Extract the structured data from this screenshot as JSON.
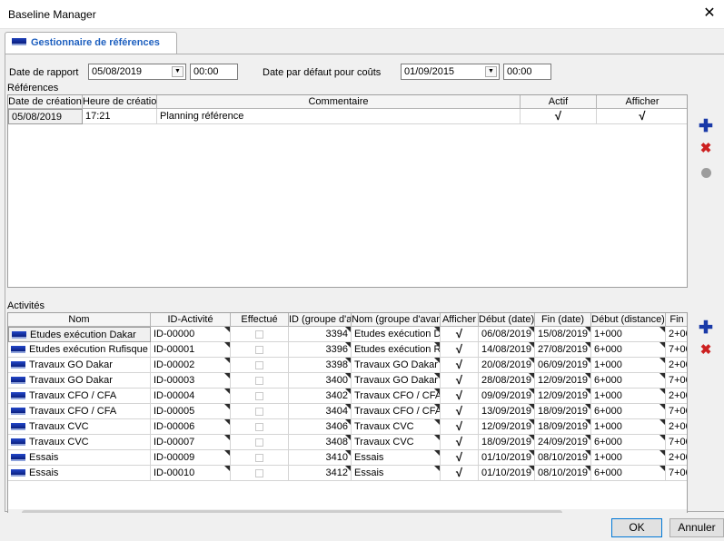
{
  "window": {
    "title": "Baseline Manager",
    "close_glyph": "✕"
  },
  "tab": {
    "label": "Gestionnaire de références",
    "icon": "baseline-icon"
  },
  "report": {
    "label": "Date de rapport",
    "date": "05/08/2019",
    "time": "00:00",
    "cost_label": "Date par défaut pour coûts",
    "cost_date": "01/09/2015",
    "cost_time": "00:00"
  },
  "references": {
    "section_label": "Références",
    "columns": [
      "Date de création",
      "Heure de création",
      "Commentaire",
      "Actif",
      "Afficher"
    ],
    "rows": [
      {
        "date": "05/08/2019",
        "time": "17:21",
        "comment": "Planning référence",
        "active": "√",
        "show": "√"
      }
    ]
  },
  "activities": {
    "section_label": "Activités",
    "columns": [
      "Nom",
      "ID-Activité",
      "Effectué",
      "ID (groupe d'a",
      "Nom (groupe d'avan",
      "Afficher",
      "Début (date)",
      "Fin (date)",
      "Début (distance)",
      "Fin"
    ],
    "rows": [
      {
        "name": "Etudes exécution Dakar",
        "id": "ID-00000",
        "done": false,
        "group_id": "3394",
        "group_name": "Etudes exécution D",
        "show": "√",
        "start": "06/08/2019",
        "end": "15/08/2019",
        "start_dist": "1+000",
        "end_dist": "2+00"
      },
      {
        "name": "Etudes exécution Rufisque",
        "id": "ID-00001",
        "done": false,
        "group_id": "3396",
        "group_name": "Etudes exécution R",
        "show": "√",
        "start": "14/08/2019",
        "end": "27/08/2019",
        "start_dist": "6+000",
        "end_dist": "7+00"
      },
      {
        "name": "Travaux GO Dakar",
        "id": "ID-00002",
        "done": false,
        "group_id": "3398",
        "group_name": "Travaux GO Dakar",
        "show": "√",
        "start": "20/08/2019",
        "end": "06/09/2019",
        "start_dist": "1+000",
        "end_dist": "2+00"
      },
      {
        "name": "Travaux GO Dakar",
        "id": "ID-00003",
        "done": false,
        "group_id": "3400",
        "group_name": "Travaux GO Dakar",
        "show": "√",
        "start": "28/08/2019",
        "end": "12/09/2019",
        "start_dist": "6+000",
        "end_dist": "7+00"
      },
      {
        "name": "Travaux CFO / CFA",
        "id": "ID-00004",
        "done": false,
        "group_id": "3402",
        "group_name": "Travaux CFO / CFA",
        "show": "√",
        "start": "09/09/2019",
        "end": "12/09/2019",
        "start_dist": "1+000",
        "end_dist": "2+00"
      },
      {
        "name": "Travaux CFO / CFA",
        "id": "ID-00005",
        "done": false,
        "group_id": "3404",
        "group_name": "Travaux CFO / CFA",
        "show": "√",
        "start": "13/09/2019",
        "end": "18/09/2019",
        "start_dist": "6+000",
        "end_dist": "7+00"
      },
      {
        "name": "Travaux CVC",
        "id": "ID-00006",
        "done": false,
        "group_id": "3406",
        "group_name": "Travaux CVC",
        "show": "√",
        "start": "12/09/2019",
        "end": "18/09/2019",
        "start_dist": "1+000",
        "end_dist": "2+00"
      },
      {
        "name": "Travaux CVC",
        "id": "ID-00007",
        "done": false,
        "group_id": "3408",
        "group_name": "Travaux CVC",
        "show": "√",
        "start": "18/09/2019",
        "end": "24/09/2019",
        "start_dist": "6+000",
        "end_dist": "7+00"
      },
      {
        "name": "Essais",
        "id": "ID-00009",
        "done": false,
        "group_id": "3410",
        "group_name": "Essais",
        "show": "√",
        "start": "01/10/2019",
        "end": "08/10/2019",
        "start_dist": "1+000",
        "end_dist": "2+00"
      },
      {
        "name": "Essais",
        "id": "ID-00010",
        "done": false,
        "group_id": "3412",
        "group_name": "Essais",
        "show": "√",
        "start": "01/10/2019",
        "end": "08/10/2019",
        "start_dist": "6+000",
        "end_dist": "7+00"
      }
    ]
  },
  "side_buttons": {
    "add": "✚",
    "remove": "✖"
  },
  "buttons": {
    "ok": "OK",
    "cancel": "Annuler"
  },
  "colors": {
    "accent": "#1d5fbf",
    "add": "#1a3aa8",
    "remove": "#cc2020"
  }
}
